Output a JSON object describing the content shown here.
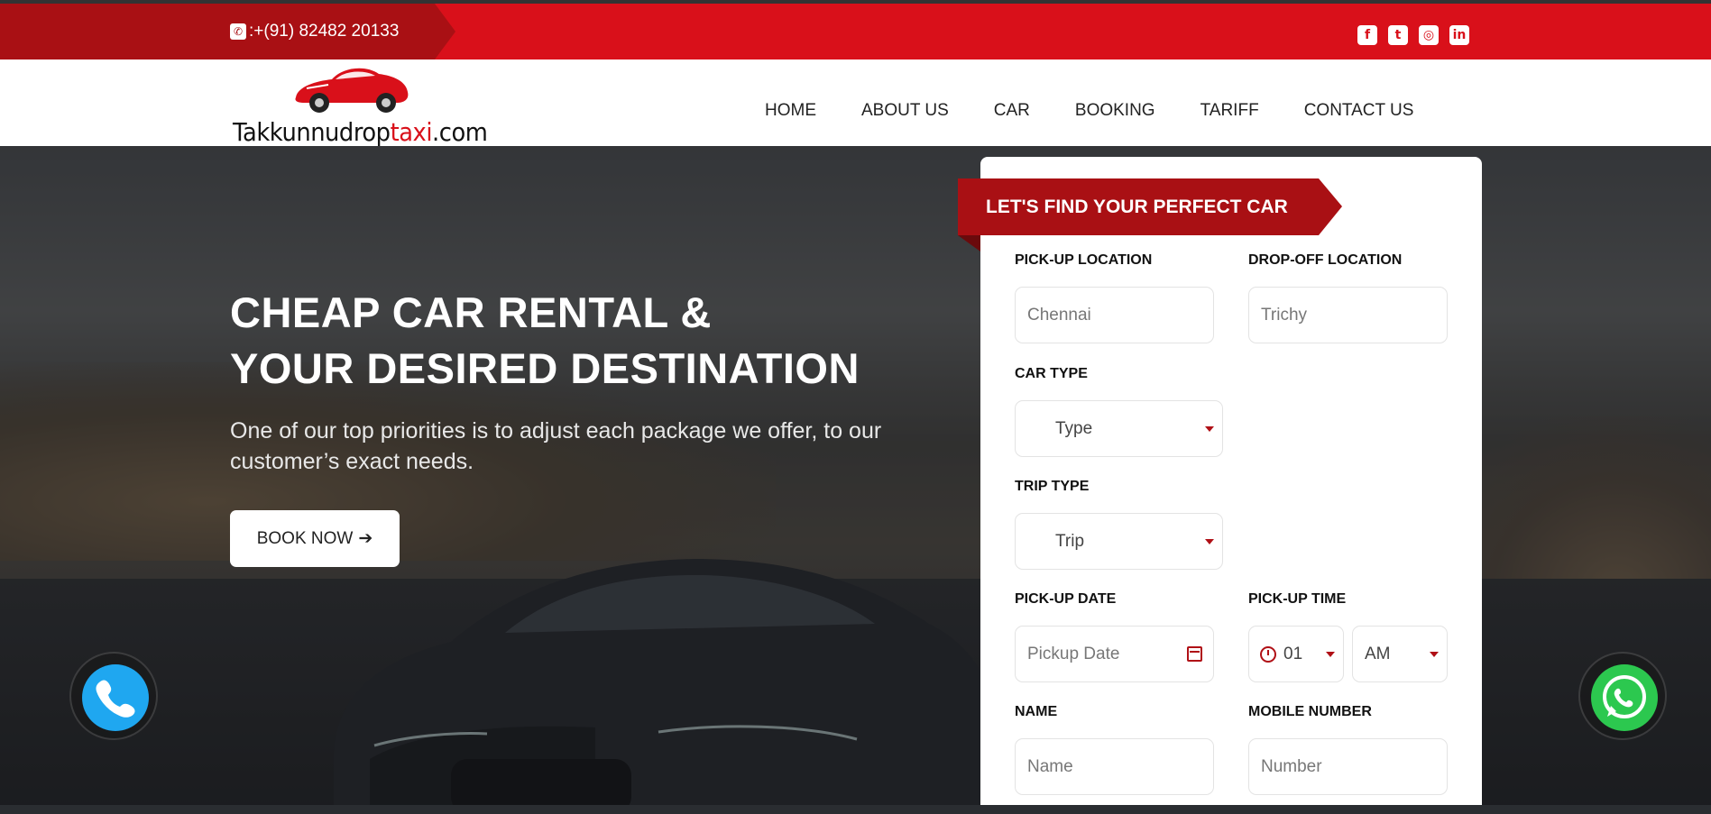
{
  "topbar": {
    "phone": ":+(91) 82482 20133",
    "phone_icon": "phone-square-icon",
    "socials": [
      {
        "icon": "facebook-icon",
        "glyph": "f"
      },
      {
        "icon": "twitter-icon",
        "glyph": "t"
      },
      {
        "icon": "instagram-icon",
        "glyph": "◎"
      },
      {
        "icon": "linkedin-icon",
        "glyph": "in"
      }
    ]
  },
  "header": {
    "logo": {
      "text_black": "Takkunnudrop",
      "text_red": "taxi",
      "text_suffix": ".com"
    },
    "nav": [
      "HOME",
      "ABOUT US",
      "CAR",
      "BOOKING",
      "TARIFF",
      "CONTACT US"
    ]
  },
  "hero": {
    "headline_line1": "CHEAP CAR RENTAL &",
    "headline_line2": "YOUR DESIRED DESTINATION",
    "subtext": "One of our top priorities is to adjust each package we offer, to our customer’s exact needs.",
    "book_button": "BOOK NOW",
    "book_button_icon": "arrow-right-icon"
  },
  "form": {
    "title": "LET'S FIND YOUR PERFECT CAR",
    "pickup_location": {
      "label": "PICK-UP LOCATION",
      "placeholder": "Chennai"
    },
    "dropoff_location": {
      "label": "DROP-OFF LOCATION",
      "placeholder": "Trichy"
    },
    "car_type": {
      "label": "CAR TYPE",
      "value": "Type"
    },
    "trip_type": {
      "label": "TRIP TYPE",
      "value": "Trip"
    },
    "pickup_date": {
      "label": "PICK-UP DATE",
      "placeholder": "Pickup Date"
    },
    "pickup_time": {
      "label": "PICK-UP TIME",
      "hour": "01",
      "meridiem": "AM"
    },
    "name": {
      "label": "NAME",
      "placeholder": "Name"
    },
    "mobile": {
      "label": "MOBILE NUMBER",
      "placeholder": "Number"
    }
  },
  "colors": {
    "brand_red": "#d9101a",
    "dark_red": "#a91014",
    "call_blue": "#1fa7f0",
    "whatsapp_green": "#2cc84f"
  }
}
